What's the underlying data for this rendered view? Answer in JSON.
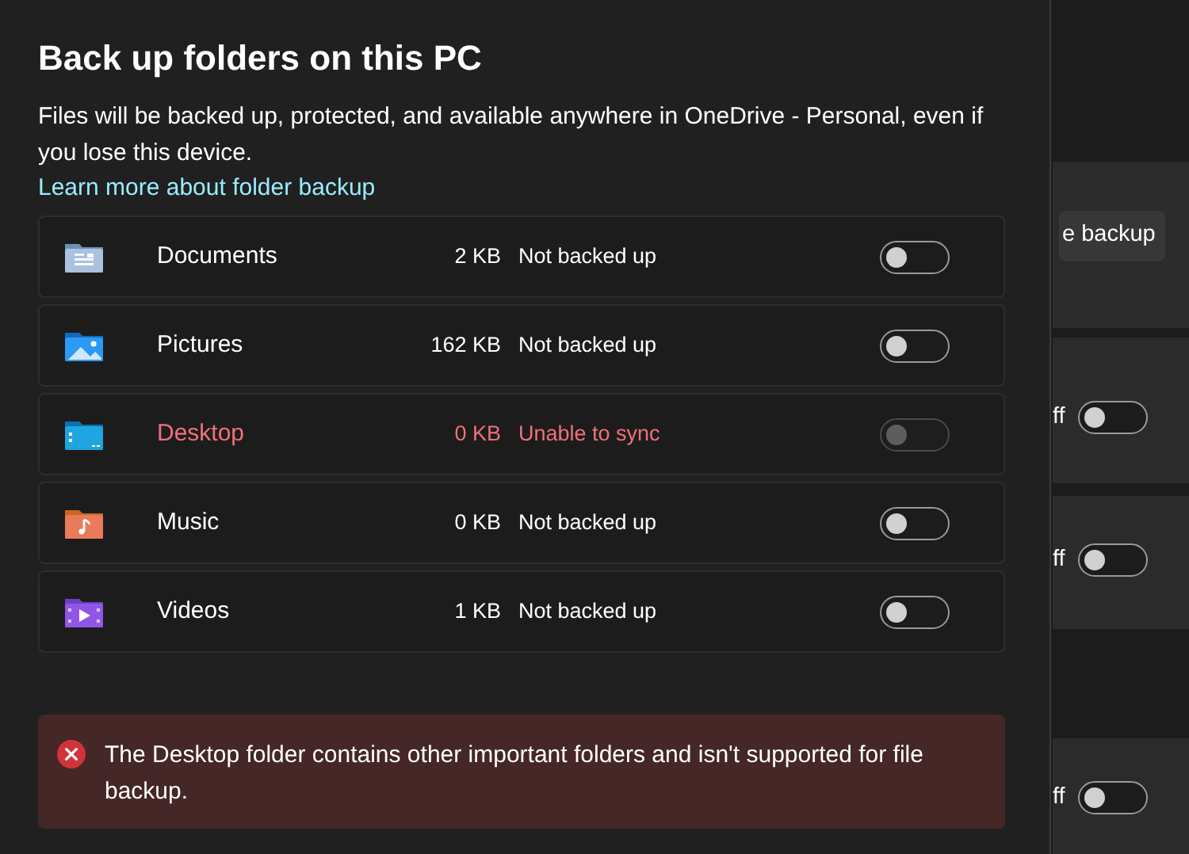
{
  "dialog": {
    "title": "Back up folders on this PC",
    "description": "Files will be backed up, protected, and available anywhere in OneDrive - Personal, even if you lose this device.",
    "link": "Learn more about folder backup",
    "folders": [
      {
        "kind": "documents",
        "name": "Documents",
        "size": "2 KB",
        "status": "Not backed up",
        "error": false,
        "on": false,
        "disabled": false
      },
      {
        "kind": "pictures",
        "name": "Pictures",
        "size": "162 KB",
        "status": "Not backed up",
        "error": false,
        "on": false,
        "disabled": false
      },
      {
        "kind": "desktop",
        "name": "Desktop",
        "size": "0 KB",
        "status": "Unable to sync",
        "error": true,
        "on": false,
        "disabled": true
      },
      {
        "kind": "music",
        "name": "Music",
        "size": "0 KB",
        "status": "Not backed up",
        "error": false,
        "on": false,
        "disabled": false
      },
      {
        "kind": "videos",
        "name": "Videos",
        "size": "1 KB",
        "status": "Not backed up",
        "error": false,
        "on": false,
        "disabled": false
      }
    ],
    "error_message": "The Desktop folder contains other important folders and isn't supported for file backup."
  },
  "background": {
    "button": "e backup",
    "toggles": [
      {
        "label": "ff",
        "on": false
      },
      {
        "label": "ff",
        "on": false
      },
      {
        "label": "ff",
        "on": false
      }
    ]
  }
}
